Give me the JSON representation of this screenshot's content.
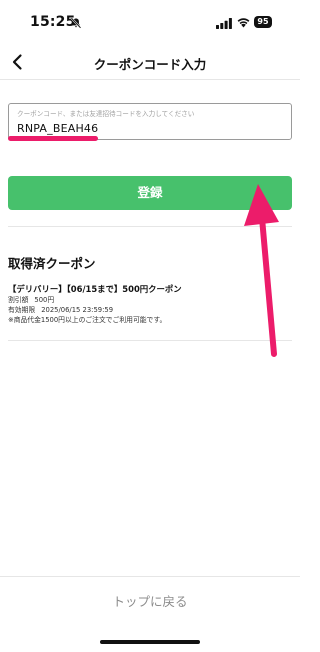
{
  "status_bar": {
    "time": "15:25",
    "battery": "95",
    "icons": [
      "mute-icon",
      "signal-icon",
      "wifi-icon",
      "battery-icon"
    ]
  },
  "nav": {
    "title": "クーポンコード入力",
    "back_icon": "chevron-left-icon"
  },
  "coupon_input": {
    "placeholder": "クーポンコード、または友達招待コードを入力してください",
    "value": "RNPA_BEAH46"
  },
  "register_button": {
    "label": "登録",
    "color": "#47c16c"
  },
  "acquired": {
    "title": "取得済クーポン",
    "coupons": [
      {
        "name": "【デリバリー】【06/15まで】500円クーポン",
        "discount_label": "割引額",
        "discount_value": "500円",
        "expiry_label": "有効期限",
        "expiry_value": "2025/06/15 23:59:59",
        "note": "※商品代金1500円以上のご注文でご利用可能です。"
      }
    ]
  },
  "footer": {
    "back_to_top": "トップに戻る"
  },
  "annotation": {
    "color": "#ec1c6a"
  }
}
